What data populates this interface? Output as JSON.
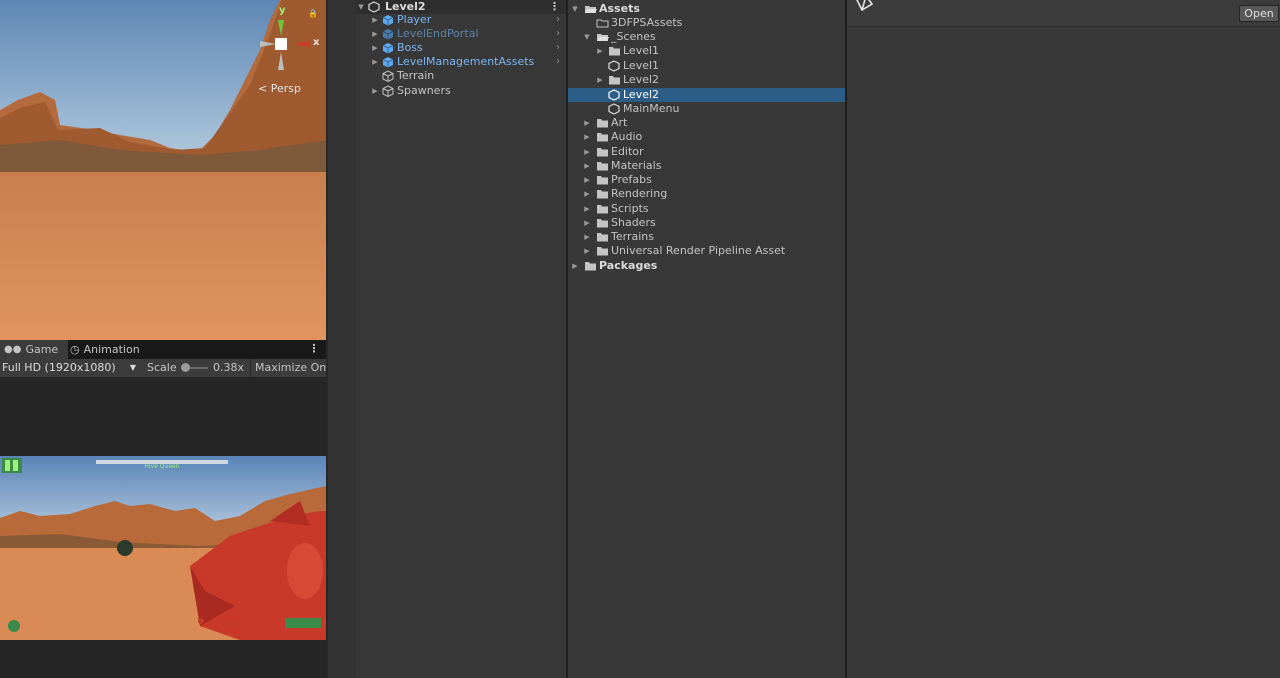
{
  "scene_view": {
    "gizmo": {
      "y_label": "y",
      "x_label": "x"
    },
    "projection_label": "< Persp",
    "lock_icon": "lock-icon"
  },
  "game_view": {
    "tabs": [
      {
        "label": "Game",
        "icon": "gamepad-icon",
        "active": true
      },
      {
        "label": "Animation",
        "icon": "clock-icon",
        "active": false
      }
    ],
    "resolution": "Full HD (1920x1080)",
    "scale_label": "Scale",
    "scale_value": "0.38x",
    "scale_level": 0.05,
    "maximize_label": "Maximize On P",
    "boss_name": "Hive Queen"
  },
  "hierarchy": {
    "root": {
      "label": "Level2",
      "icon": "unity-scene-icon"
    },
    "items": [
      {
        "label": "Player",
        "icon": "prefab-cube-icon",
        "style": "prefab",
        "has_children": true
      },
      {
        "label": "LevelEndPortal",
        "icon": "prefab-cube-icon",
        "style": "prefab-dim",
        "has_children": true
      },
      {
        "label": "Boss",
        "icon": "prefab-cube-icon",
        "style": "prefab",
        "has_children": true
      },
      {
        "label": "LevelManagementAssets",
        "icon": "prefab-cube-icon",
        "style": "prefab",
        "has_children": true
      },
      {
        "label": "Terrain",
        "icon": "gameobject-cube-icon",
        "style": "plain",
        "has_children": false
      },
      {
        "label": "Spawners",
        "icon": "gameobject-cube-icon",
        "style": "plain",
        "has_children": true
      }
    ]
  },
  "project": {
    "tree": [
      {
        "label": "Assets",
        "icon": "folder-open-icon",
        "expanded": true,
        "bold": true
      },
      {
        "label": "3DFPSAssets",
        "icon": "folder-outline-icon"
      },
      {
        "label": "_Scenes",
        "icon": "folder-open-icon",
        "expanded": true
      },
      {
        "label": "Level1",
        "icon": "folder-icon"
      },
      {
        "label": "Level1",
        "icon": "unity-scene-icon"
      },
      {
        "label": "Level2",
        "icon": "folder-icon"
      },
      {
        "label": "Level2",
        "icon": "unity-scene-icon",
        "selected": true
      },
      {
        "label": "MainMenu",
        "icon": "unity-scene-icon"
      },
      {
        "label": "Art",
        "icon": "folder-icon"
      },
      {
        "label": "Audio",
        "icon": "folder-icon"
      },
      {
        "label": "Editor",
        "icon": "folder-icon"
      },
      {
        "label": "Materials",
        "icon": "folder-icon"
      },
      {
        "label": "Prefabs",
        "icon": "folder-icon"
      },
      {
        "label": "Rendering",
        "icon": "folder-icon"
      },
      {
        "label": "Scripts",
        "icon": "folder-icon"
      },
      {
        "label": "Shaders",
        "icon": "folder-icon"
      },
      {
        "label": "Terrains",
        "icon": "folder-icon"
      },
      {
        "label": "Universal Render Pipeline Asset",
        "icon": "folder-icon"
      },
      {
        "label": "Packages",
        "icon": "folder-icon",
        "bold": true
      }
    ]
  },
  "inspector": {
    "open_label": "Open",
    "header_icon": "unity-scene-icon"
  },
  "colors": {
    "selection": "#2c5d87",
    "prefab_text": "#7cb6f2",
    "panel_bg": "#383838"
  }
}
